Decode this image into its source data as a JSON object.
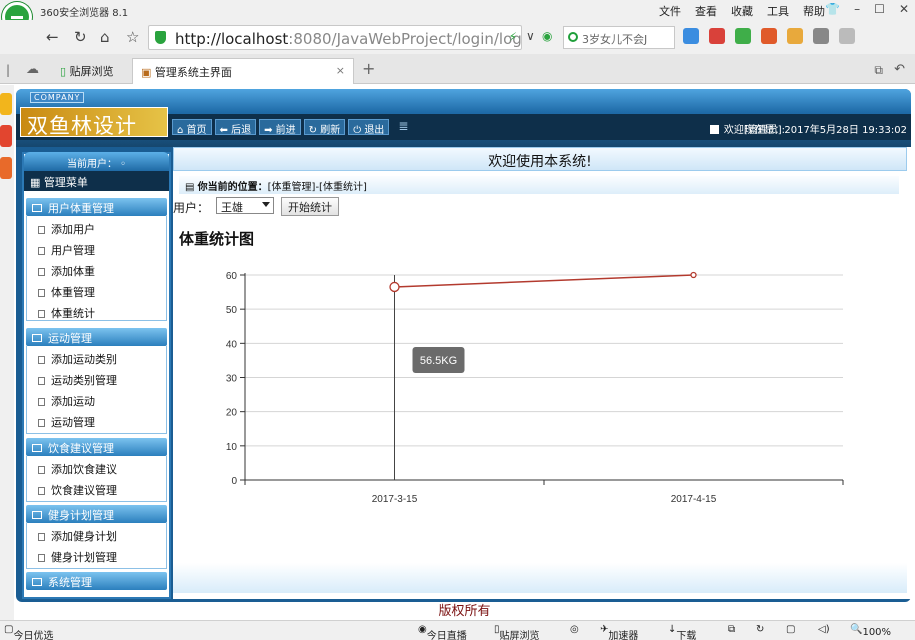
{
  "browser": {
    "title": "360安全浏览器 8.1",
    "menu": [
      "文件",
      "查看",
      "收藏",
      "工具",
      "帮助"
    ],
    "url_host": "http://localhost",
    "url_rest": ":8080/JavaWebProject/login/log",
    "search_text": "3岁女儿不会J",
    "tabs": [
      {
        "label": "贴屏浏览"
      },
      {
        "label": "管理系统主界面"
      }
    ],
    "status": {
      "left": "今日优选",
      "items": [
        "今日直播",
        "贴屏浏览",
        "加速器",
        "下载",
        "100%"
      ]
    }
  },
  "header": {
    "company": "COMPANY",
    "brand": "双鱼林设计",
    "nav": [
      "首页",
      "后退",
      "前进",
      "刷新",
      "退出"
    ],
    "welcome_user": "欢迎[管理员]:",
    "datetime": "现在是：2017年5月28日 19:33:02"
  },
  "sidebar": {
    "current_user": "当前用户：",
    "menu_title": "管理菜单",
    "groups": [
      {
        "title": "用户体重管理",
        "items": [
          "添加用户",
          "用户管理",
          "添加体重",
          "体重管理",
          "体重统计"
        ]
      },
      {
        "title": "运动管理",
        "items": [
          "添加运动类别",
          "运动类别管理",
          "添加运动",
          "运动管理"
        ]
      },
      {
        "title": "饮食建议管理",
        "items": [
          "添加饮食建议",
          "饮食建议管理"
        ]
      },
      {
        "title": "健身计划管理",
        "items": [
          "添加健身计划",
          "健身计划管理"
        ]
      },
      {
        "title": "系统管理",
        "items": []
      }
    ]
  },
  "main": {
    "welcome": "欢迎使用本系统!",
    "crumb_label": "你当前的位置：",
    "crumb_path": "[体重管理]-[体重统计]",
    "user_label": "用户：",
    "user_value": "王雄",
    "stat_button": "开始统计",
    "chart_title": "体重统计图",
    "tooltip": "56.5KG"
  },
  "footer": {
    "copyright": "版权所有"
  },
  "chart_data": {
    "type": "line",
    "title": "体重统计图",
    "categories": [
      "2017-3-15",
      "2017-4-15"
    ],
    "series": [
      {
        "values": [
          56.5,
          60
        ]
      }
    ],
    "ylim": [
      0,
      60
    ],
    "yticks": [
      0,
      10,
      20,
      30,
      40,
      50,
      60
    ],
    "grid": true,
    "colors": {
      "line": "#b33a2e"
    }
  }
}
